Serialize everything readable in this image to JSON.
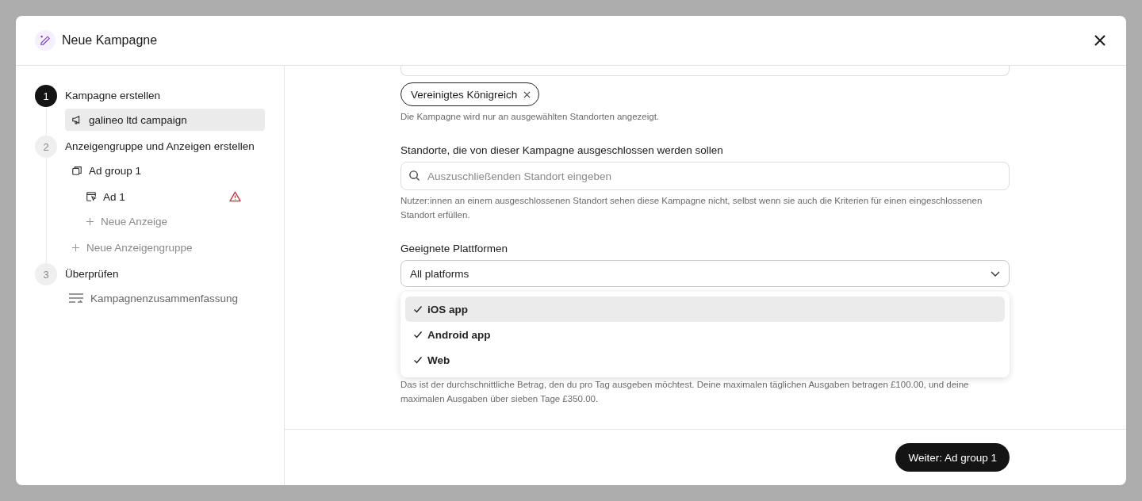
{
  "dialog": {
    "title": "Neue Kampagne"
  },
  "steps": [
    {
      "number": "1",
      "label": "Kampagne erstellen",
      "active": true,
      "children": [
        {
          "kind": "campaign",
          "label": "galineo ltd campaign",
          "selected": true,
          "warning": false
        }
      ]
    },
    {
      "number": "2",
      "label": "Anzeigengruppe und Anzeigen erstellen",
      "active": false,
      "children": [
        {
          "kind": "adgroup",
          "label": "Ad group 1",
          "selected": false,
          "warning": false,
          "children": [
            {
              "kind": "ad",
              "label": "Ad 1",
              "selected": false,
              "warning": true
            },
            {
              "kind": "add",
              "label": "Neue Anzeige",
              "selected": false,
              "warning": false
            }
          ]
        },
        {
          "kind": "add",
          "label": "Neue Anzeigengruppe",
          "selected": false,
          "warning": false
        }
      ]
    },
    {
      "number": "3",
      "label": "Überprüfen",
      "active": false,
      "children": [
        {
          "kind": "summary",
          "label": "Kampagnenzusammenfassung",
          "selected": false,
          "warning": false
        }
      ]
    }
  ],
  "form": {
    "included_tags": [
      {
        "label": "Vereinigtes Königreich"
      }
    ],
    "included_help": "Die Kampagne wird nur an ausgewählten Standorten angezeigt.",
    "exclude": {
      "label": "Standorte, die von dieser Kampagne ausgeschlossen werden sollen",
      "placeholder": "Auszuschließenden Standort eingeben",
      "help": "Nutzer:innen an einem ausgeschlossenen Standort sehen diese Kampagne nicht, selbst wenn sie auch die Kriterien für einen eingeschlossenen Standort erfüllen."
    },
    "platforms": {
      "label": "Geeignete Plattformen",
      "value": "All platforms",
      "expanded": true,
      "options": [
        {
          "label": "iOS app",
          "checked": true,
          "highlighted": true
        },
        {
          "label": "Android app",
          "checked": true,
          "highlighted": false
        },
        {
          "label": "Web",
          "checked": true,
          "highlighted": false
        }
      ]
    },
    "budget_help": "Das ist der durchschnittliche Betrag, den du pro Tag ausgeben möchtest. Deine maximalen täglichen Ausgaben betragen £100.00, und deine maximalen Ausgaben über sieben Tage £350.00."
  },
  "footer": {
    "next_button": "Weiter: Ad group 1"
  }
}
